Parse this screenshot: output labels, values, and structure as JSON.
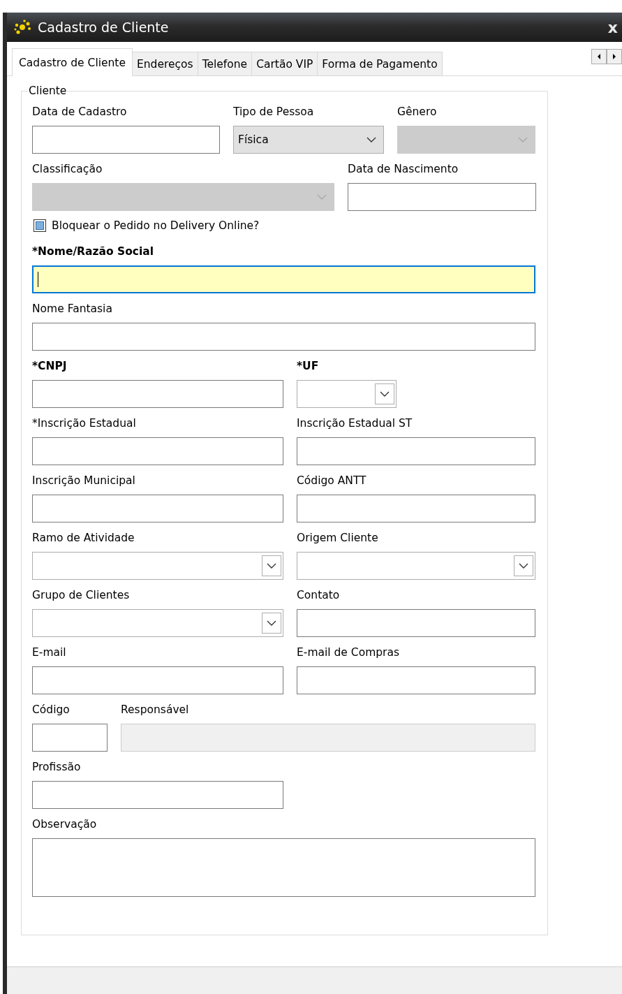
{
  "window": {
    "title": "Cadastro de Cliente",
    "close": "x"
  },
  "tabs": [
    {
      "label": "Cadastro de Cliente",
      "selected": true
    },
    {
      "label": "Endereços",
      "selected": false
    },
    {
      "label": "Telefone",
      "selected": false
    },
    {
      "label": "Cartão VIP",
      "selected": false
    },
    {
      "label": "Forma de Pagamento",
      "selected": false
    }
  ],
  "group": {
    "title": "Cliente",
    "rows": [
      {
        "fields": [
          {
            "label": "Data de Cadastro",
            "kind": "text",
            "bold": false,
            "disabled": false,
            "focused": false
          },
          {
            "label": "Tipo de Pessoa",
            "kind": "dropdown",
            "value": "Física",
            "bold": false,
            "disabled": false,
            "focused": false
          },
          {
            "label": "Gênero",
            "kind": "dropdown",
            "bold": false,
            "disabled": true,
            "focused": false
          }
        ]
      },
      {
        "fields": [
          {
            "label": "Classificação",
            "kind": "dropdown",
            "bold": false,
            "disabled": true,
            "focused": false
          },
          {
            "label": "Data de Nascimento",
            "kind": "text",
            "bold": false,
            "disabled": false,
            "focused": false
          }
        ]
      },
      {
        "checkbox": {
          "label": "Bloquear o Pedido no Delivery Online?",
          "indeterminate": true
        }
      },
      {
        "fields": [
          {
            "label": "*Nome/Razão Social",
            "kind": "text",
            "bold": true,
            "disabled": false,
            "focused": true
          }
        ]
      },
      {
        "fields": [
          {
            "label": "Nome Fantasia",
            "kind": "text",
            "bold": false,
            "disabled": false,
            "focused": false
          }
        ]
      },
      {
        "fields": [
          {
            "label": "*CNPJ",
            "kind": "text",
            "bold": true,
            "disabled": false,
            "focused": false
          },
          {
            "label": "*UF",
            "kind": "combo",
            "bold": true,
            "disabled": false,
            "focused": false
          }
        ]
      },
      {
        "fields": [
          {
            "label": "*Inscrição Estadual",
            "kind": "text",
            "bold": false,
            "disabled": false,
            "focused": false
          },
          {
            "label": "Inscrição Estadual ST",
            "kind": "text",
            "bold": false,
            "disabled": false,
            "focused": false
          }
        ]
      },
      {
        "fields": [
          {
            "label": "Inscrição Municipal",
            "kind": "text",
            "bold": false,
            "disabled": false,
            "focused": false
          },
          {
            "label": "Código ANTT",
            "kind": "text",
            "bold": false,
            "disabled": false,
            "focused": false
          }
        ]
      },
      {
        "fields": [
          {
            "label": "Ramo de Atividade",
            "kind": "combo",
            "bold": false,
            "disabled": false,
            "focused": false
          },
          {
            "label": "Origem Cliente",
            "kind": "combo",
            "bold": false,
            "disabled": false,
            "focused": false
          }
        ]
      },
      {
        "fields": [
          {
            "label": "Grupo de Clientes",
            "kind": "combo",
            "bold": false,
            "disabled": false,
            "focused": false
          },
          {
            "label": "Contato",
            "kind": "text",
            "bold": false,
            "disabled": false,
            "focused": false
          }
        ]
      },
      {
        "fields": [
          {
            "label": "E-mail",
            "kind": "text",
            "bold": false,
            "disabled": false,
            "focused": false
          },
          {
            "label": "E-mail de Compras",
            "kind": "text",
            "bold": false,
            "disabled": false,
            "focused": false
          }
        ]
      },
      {
        "fields": [
          {
            "label": "Código",
            "kind": "text",
            "bold": false,
            "disabled": false,
            "focused": false
          },
          {
            "label": "Responsável",
            "kind": "text",
            "bold": false,
            "disabled": true,
            "focused": false
          }
        ]
      },
      {
        "fields": [
          {
            "label": "Profissão",
            "kind": "text",
            "bold": false,
            "disabled": false,
            "focused": false
          }
        ]
      },
      {
        "fields": [
          {
            "label": "Observação",
            "kind": "textarea",
            "bold": false,
            "disabled": false,
            "focused": false
          }
        ]
      }
    ]
  }
}
